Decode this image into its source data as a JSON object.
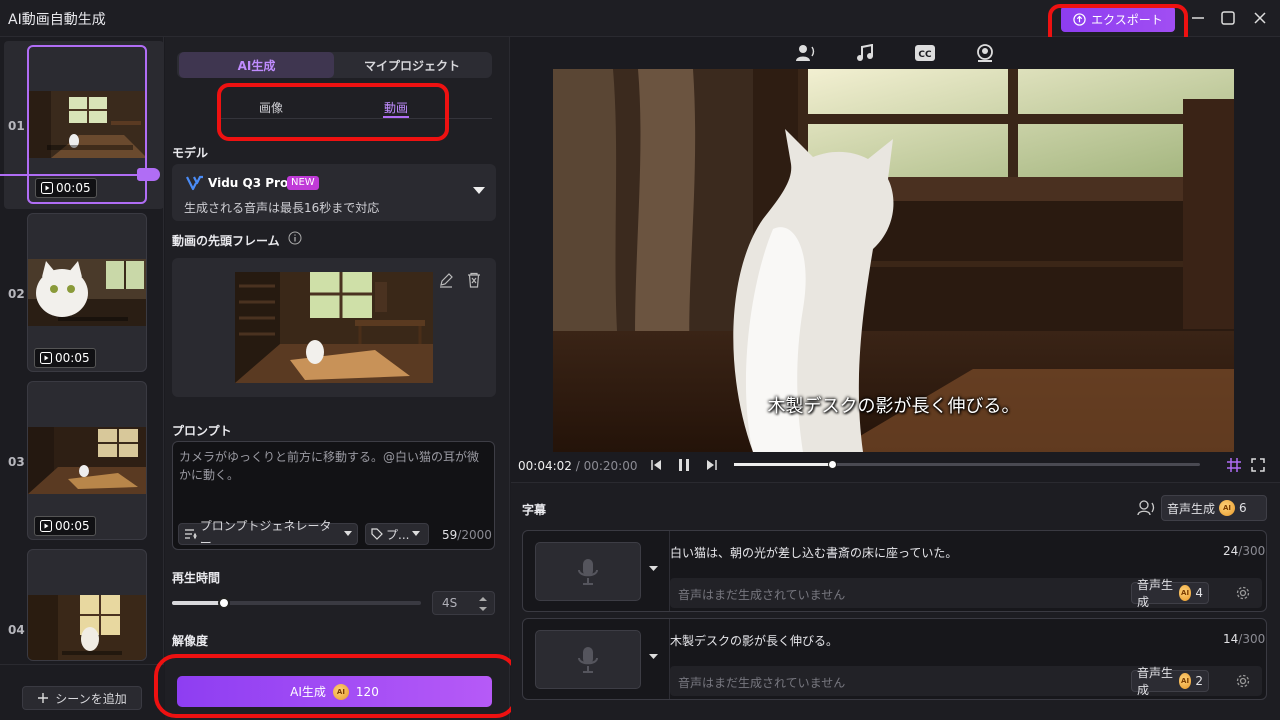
{
  "title_bar": {
    "title": "AI動画自動生成",
    "export_label": "エクスポート"
  },
  "scenes": [
    {
      "num": "01",
      "duration": "00:05"
    },
    {
      "num": "02",
      "duration": "00:05"
    },
    {
      "num": "03",
      "duration": "00:05"
    },
    {
      "num": "04",
      "duration": ""
    }
  ],
  "add_scene_label": "シーンを追加",
  "panel": {
    "main_tabs": [
      "AI生成",
      "マイプロジェクト"
    ],
    "sub_tabs": [
      "画像",
      "動画"
    ],
    "model_label": "モデル",
    "model_name": "Vidu Q3 Pro",
    "model_badge": "NEW",
    "model_desc": "生成される音声は最長16秒まで対応",
    "first_frame_label": "動画の先頭フレーム",
    "prompt_label": "プロンプト",
    "prompt_text": "カメラがゆっくりと前方に移動する。@白い猫の耳が微かに動く。",
    "prompt_generator_label": "プロンプトジェネレーター",
    "tag_label": "プ...",
    "char_count": "59",
    "char_max": "/2000",
    "duration_label": "再生時間",
    "duration_value": "4S",
    "duration_slider_fraction": 0.21,
    "resolution_label": "解像度",
    "ai_generate_label": "AI生成",
    "ai_generate_cost": "120"
  },
  "preview": {
    "subtitle_overlay": "木製デスクの影が長く伸びる。",
    "current_time": "00:04:02",
    "total_time": "/ 00:20:00",
    "progress_fraction": 0.21
  },
  "subtitles": {
    "header": "字幕",
    "voice_gen_label": "音声生成",
    "voice_gen_cost": "6",
    "items": [
      {
        "text": "白い猫は、朝の光が差し込む書斎の床に座っていた。",
        "count": "24",
        "max": "/300",
        "status": "音声はまだ生成されていません",
        "gen_label": "音声生成",
        "cost": "4"
      },
      {
        "text": "木製デスクの影が長く伸びる。",
        "count": "14",
        "max": "/300",
        "status": "音声はまだ生成されていません",
        "gen_label": "音声生成",
        "cost": "2"
      }
    ]
  },
  "colors": {
    "accent": "#b06df5",
    "export_bg": "#8d3df0",
    "highlight": "#ee1111"
  }
}
